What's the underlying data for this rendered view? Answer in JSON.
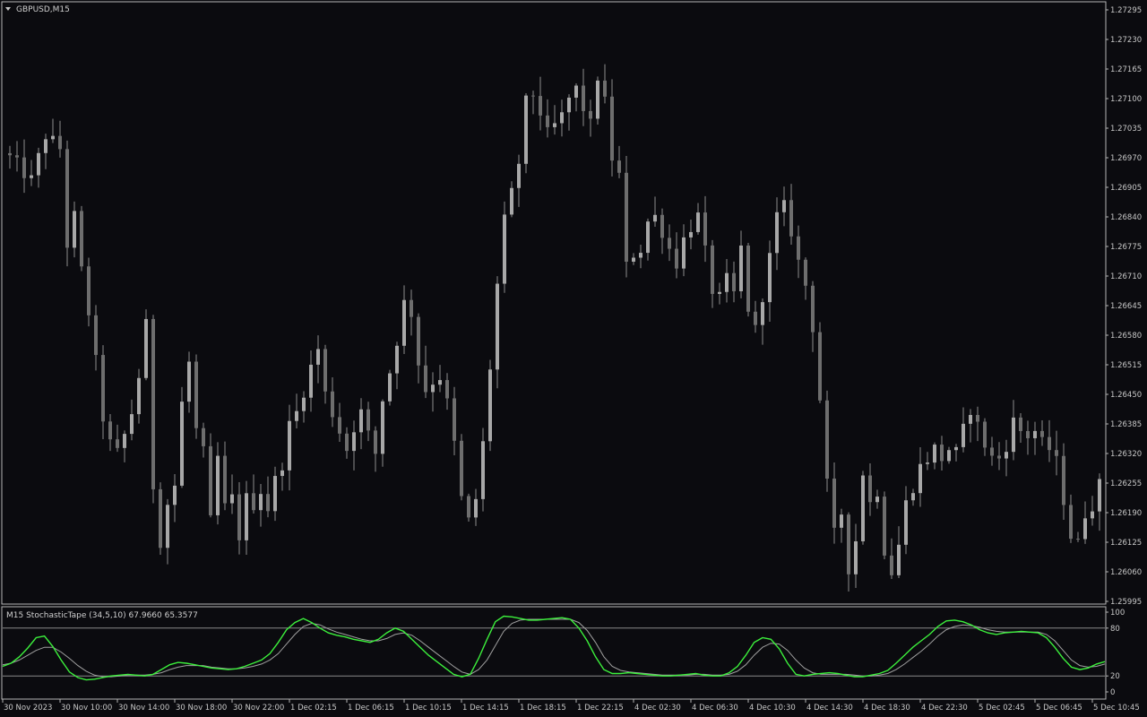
{
  "chart_data": [
    {
      "type": "candlestick",
      "title": "GBPUSD,M15",
      "symbol": "GBPUSD",
      "timeframe": "M15",
      "y_ticks": [
        "1.27295",
        "1.27230",
        "1.27165",
        "1.27100",
        "1.27035",
        "1.26970",
        "1.26905",
        "1.26840",
        "1.26775",
        "1.26710",
        "1.26645",
        "1.26580",
        "1.26515",
        "1.26450",
        "1.26385",
        "1.26320",
        "1.26255",
        "1.26190",
        "1.26125",
        "1.26060",
        "1.25995"
      ],
      "ylim": [
        1.25995,
        1.27295
      ],
      "x_ticks": [
        "30 Nov 2023",
        "30 Nov 10:00",
        "30 Nov 14:00",
        "30 Nov 18:00",
        "30 Nov 22:00",
        "1 Dec 02:15",
        "1 Dec 06:15",
        "1 Dec 10:15",
        "1 Dec 14:15",
        "1 Dec 18:15",
        "1 Dec 22:15",
        "4 Dec 02:30",
        "4 Dec 06:30",
        "4 Dec 10:30",
        "4 Dec 14:30",
        "4 Dec 18:30",
        "4 Dec 22:30",
        "5 Dec 02:45",
        "5 Dec 06:45",
        "5 Dec 10:45"
      ],
      "close_path": [
        [
          0,
          1.2697
        ],
        [
          3,
          1.2692
        ],
        [
          5,
          1.2702
        ],
        [
          7,
          1.2699
        ],
        [
          8,
          1.2678
        ],
        [
          9,
          1.2684
        ],
        [
          10,
          1.2672
        ],
        [
          11,
          1.2663
        ],
        [
          12,
          1.2652
        ],
        [
          13,
          1.264
        ],
        [
          14,
          1.2634
        ],
        [
          15,
          1.2632
        ],
        [
          16,
          1.2636
        ],
        [
          17,
          1.2641
        ],
        [
          18,
          1.2649
        ],
        [
          19,
          1.266
        ],
        [
          20,
          1.2625
        ],
        [
          21,
          1.2613
        ],
        [
          22,
          1.2621
        ],
        [
          23,
          1.2625
        ],
        [
          24,
          1.2643
        ],
        [
          25,
          1.2652
        ],
        [
          26,
          1.2637
        ],
        [
          27,
          1.2632
        ],
        [
          28,
          1.2617
        ],
        [
          29,
          1.2631
        ],
        [
          30,
          1.262
        ],
        [
          31,
          1.2622
        ],
        [
          32,
          1.2614
        ],
        [
          33,
          1.2622
        ],
        [
          34,
          1.2621
        ],
        [
          35,
          1.2624
        ],
        [
          36,
          1.262
        ],
        [
          37,
          1.2626
        ],
        [
          38,
          1.263
        ],
        [
          39,
          1.2638
        ],
        [
          40,
          1.2641
        ],
        [
          41,
          1.2646
        ],
        [
          42,
          1.2651
        ],
        [
          43,
          1.2655
        ],
        [
          44,
          1.2645
        ],
        [
          45,
          1.2641
        ],
        [
          46,
          1.2637
        ],
        [
          47,
          1.2633
        ],
        [
          48,
          1.2638
        ],
        [
          49,
          1.2641
        ],
        [
          50,
          1.2636
        ],
        [
          51,
          1.2632
        ],
        [
          52,
          1.2644
        ],
        [
          53,
          1.265
        ],
        [
          54,
          1.2657
        ],
        [
          55,
          1.2665
        ],
        [
          56,
          1.2663
        ],
        [
          57,
          1.2652
        ],
        [
          58,
          1.2646
        ],
        [
          59,
          1.2648
        ],
        [
          60,
          1.2649
        ],
        [
          61,
          1.2643
        ],
        [
          62,
          1.2634
        ],
        [
          63,
          1.2622
        ],
        [
          64,
          1.2617
        ],
        [
          65,
          1.2622
        ],
        [
          66,
          1.2634
        ],
        [
          67,
          1.2651
        ],
        [
          68,
          1.2669
        ],
        [
          69,
          1.2683
        ],
        [
          70,
          1.2689
        ],
        [
          71,
          1.2696
        ],
        [
          72,
          1.2709
        ],
        [
          73,
          1.2711
        ],
        [
          74,
          1.2707
        ],
        [
          75,
          1.2702
        ],
        [
          76,
          1.2704
        ],
        [
          77,
          1.2706
        ],
        [
          78,
          1.271
        ],
        [
          79,
          1.2712
        ],
        [
          80,
          1.2708
        ],
        [
          81,
          1.2704
        ],
        [
          82,
          1.2715
        ],
        [
          83,
          1.2709
        ],
        [
          84,
          1.2697
        ],
        [
          85,
          1.2693
        ],
        [
          86,
          1.2673
        ],
        [
          87,
          1.2676
        ],
        [
          88,
          1.2677
        ],
        [
          89,
          1.2683
        ],
        [
          90,
          1.2684
        ],
        [
          91,
          1.2681
        ],
        [
          92,
          1.2677
        ],
        [
          93,
          1.2674
        ],
        [
          94,
          1.2679
        ],
        [
          95,
          1.2682
        ],
        [
          96,
          1.2684
        ],
        [
          97,
          1.2676
        ],
        [
          98,
          1.2668
        ],
        [
          99,
          1.2666
        ],
        [
          100,
          1.267
        ],
        [
          101,
          1.2667
        ],
        [
          102,
          1.2677
        ],
        [
          103,
          1.2664
        ],
        [
          104,
          1.2659
        ],
        [
          105,
          1.2667
        ],
        [
          106,
          1.2675
        ],
        [
          107,
          1.2684
        ],
        [
          108,
          1.2686
        ],
        [
          109,
          1.2681
        ],
        [
          110,
          1.2674
        ],
        [
          111,
          1.2669
        ],
        [
          112,
          1.266
        ],
        [
          113,
          1.2644
        ],
        [
          114,
          1.2625
        ],
        [
          115,
          1.2614
        ],
        [
          116,
          1.2619
        ],
        [
          117,
          1.2607
        ],
        [
          118,
          1.2613
        ],
        [
          119,
          1.2628
        ],
        [
          120,
          1.2621
        ],
        [
          121,
          1.2624
        ],
        [
          122,
          1.2611
        ],
        [
          123,
          1.2606
        ],
        [
          124,
          1.2612
        ],
        [
          125,
          1.2621
        ],
        [
          126,
          1.2625
        ],
        [
          127,
          1.2629
        ],
        [
          128,
          1.2631
        ],
        [
          129,
          1.2633
        ],
        [
          130,
          1.2631
        ],
        [
          131,
          1.2633
        ],
        [
          132,
          1.2632
        ],
        [
          133,
          1.2637
        ],
        [
          134,
          1.2642
        ],
        [
          135,
          1.2638
        ],
        [
          136,
          1.2634
        ],
        [
          137,
          1.2631
        ],
        [
          138,
          1.2631
        ],
        [
          139,
          1.2634
        ],
        [
          140,
          1.2639
        ],
        [
          141,
          1.2637
        ],
        [
          142,
          1.2636
        ],
        [
          143,
          1.2637
        ],
        [
          144,
          1.2634
        ],
        [
          145,
          1.2633
        ],
        [
          146,
          1.263
        ],
        [
          147,
          1.2622
        ],
        [
          148,
          1.2614
        ],
        [
          149,
          1.2612
        ],
        [
          150,
          1.2619
        ],
        [
          151,
          1.2621
        ],
        [
          152,
          1.2625
        ]
      ],
      "bar_count": 153
    },
    {
      "type": "line",
      "title": "M15 StochasticTape (34,5,10) 67.9660 65.3577",
      "indicator": "StochasticTape",
      "params": "(34,5,10)",
      "current_values": [
        67.966,
        65.3577
      ],
      "y_ticks": [
        "100",
        "80",
        "20",
        "0"
      ],
      "levels": [
        80,
        20
      ],
      "ylim": [
        0,
        100
      ],
      "series": [
        {
          "color": "#3cf03c",
          "values": [
            32,
            36,
            44,
            55,
            68,
            70,
            57,
            40,
            25,
            18,
            15,
            16,
            18,
            20,
            21,
            22,
            21,
            20,
            22,
            28,
            34,
            37,
            36,
            34,
            32,
            30,
            29,
            28,
            29,
            32,
            36,
            40,
            48,
            62,
            78,
            87,
            92,
            87,
            80,
            74,
            71,
            69,
            66,
            64,
            62,
            66,
            74,
            80,
            76,
            66,
            56,
            46,
            38,
            30,
            22,
            19,
            22,
            42,
            66,
            88,
            95,
            94,
            92,
            90,
            90,
            91,
            92,
            93,
            91,
            80,
            64,
            44,
            28,
            23,
            23,
            24,
            23,
            22,
            21,
            20,
            20,
            21,
            22,
            23,
            21,
            20,
            20,
            24,
            32,
            46,
            62,
            68,
            66,
            54,
            36,
            22,
            20,
            22,
            23,
            24,
            23,
            21,
            19,
            19,
            21,
            23,
            27,
            36,
            46,
            56,
            64,
            72,
            82,
            89,
            90,
            88,
            84,
            78,
            74,
            72,
            74,
            75,
            76,
            75,
            74,
            68,
            56,
            42,
            31,
            28,
            30,
            35,
            38
          ]
        },
        {
          "color": "#a0a0a0",
          "values": [
            34,
            36,
            40,
            46,
            52,
            56,
            56,
            50,
            42,
            33,
            26,
            21,
            19,
            19,
            20,
            21,
            21,
            21,
            22,
            24,
            28,
            31,
            33,
            33,
            33,
            31,
            30,
            29,
            29,
            30,
            32,
            35,
            40,
            48,
            60,
            72,
            82,
            86,
            84,
            79,
            75,
            72,
            69,
            66,
            64,
            64,
            67,
            72,
            74,
            71,
            64,
            56,
            48,
            40,
            32,
            25,
            22,
            28,
            40,
            58,
            76,
            86,
            90,
            91,
            91,
            91,
            91,
            91,
            91,
            87,
            77,
            62,
            44,
            32,
            27,
            25,
            24,
            23,
            22,
            21,
            21,
            21,
            21,
            22,
            22,
            21,
            21,
            22,
            26,
            34,
            46,
            56,
            61,
            60,
            52,
            40,
            30,
            24,
            22,
            22,
            22,
            22,
            21,
            20,
            20,
            21,
            23,
            28,
            35,
            43,
            51,
            60,
            70,
            78,
            82,
            84,
            83,
            81,
            78,
            76,
            75,
            75,
            75,
            75,
            75,
            72,
            64,
            52,
            40,
            33,
            31,
            32,
            35
          ]
        }
      ]
    }
  ]
}
